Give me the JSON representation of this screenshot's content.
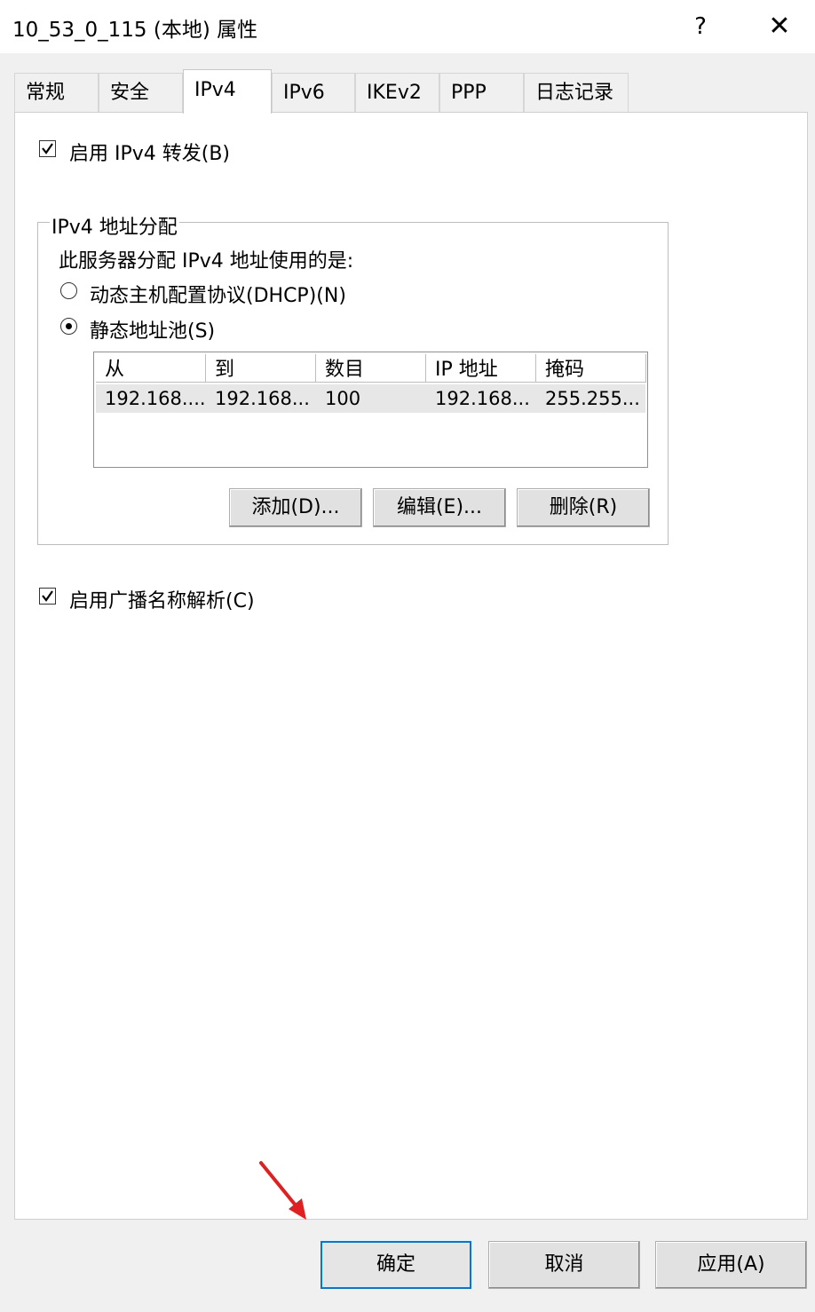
{
  "window": {
    "title": "10_53_0_115 (本地) 属性",
    "help_label": "?",
    "close_label": "✕"
  },
  "tabs": [
    {
      "label": "常规",
      "active": false
    },
    {
      "label": "安全",
      "active": false
    },
    {
      "label": "IPv4",
      "active": true
    },
    {
      "label": "IPv6",
      "active": false
    },
    {
      "label": "IKEv2",
      "active": false
    },
    {
      "label": "PPP",
      "active": false
    },
    {
      "label": "日志记录",
      "active": false
    }
  ],
  "ipv4": {
    "enable_forwarding": {
      "label": "启用 IPv4 转发(B)",
      "checked": true
    },
    "assignment_group": {
      "title": "IPv4 地址分配",
      "prompt": "此服务器分配 IPv4 地址使用的是:",
      "dhcp_option": {
        "label": "动态主机配置协议(DHCP)(N)",
        "selected": false
      },
      "static_option": {
        "label": "静态地址池(S)",
        "selected": true
      },
      "pool_table": {
        "columns": [
          "从",
          "到",
          "数目",
          "IP 地址",
          "掩码"
        ],
        "rows": [
          [
            "192.168....",
            "192.168...",
            "100",
            "192.168...",
            "255.255..."
          ]
        ]
      },
      "buttons": {
        "add": "添加(D)...",
        "edit": "编辑(E)...",
        "remove": "删除(R)"
      }
    },
    "enable_broadcast": {
      "label": "启用广播名称解析(C)",
      "checked": true
    }
  },
  "footer": {
    "ok": "确定",
    "cancel": "取消",
    "apply": "应用(A)"
  },
  "colors": {
    "accent": "#0078d7",
    "annotation_arrow": "#e02020"
  }
}
